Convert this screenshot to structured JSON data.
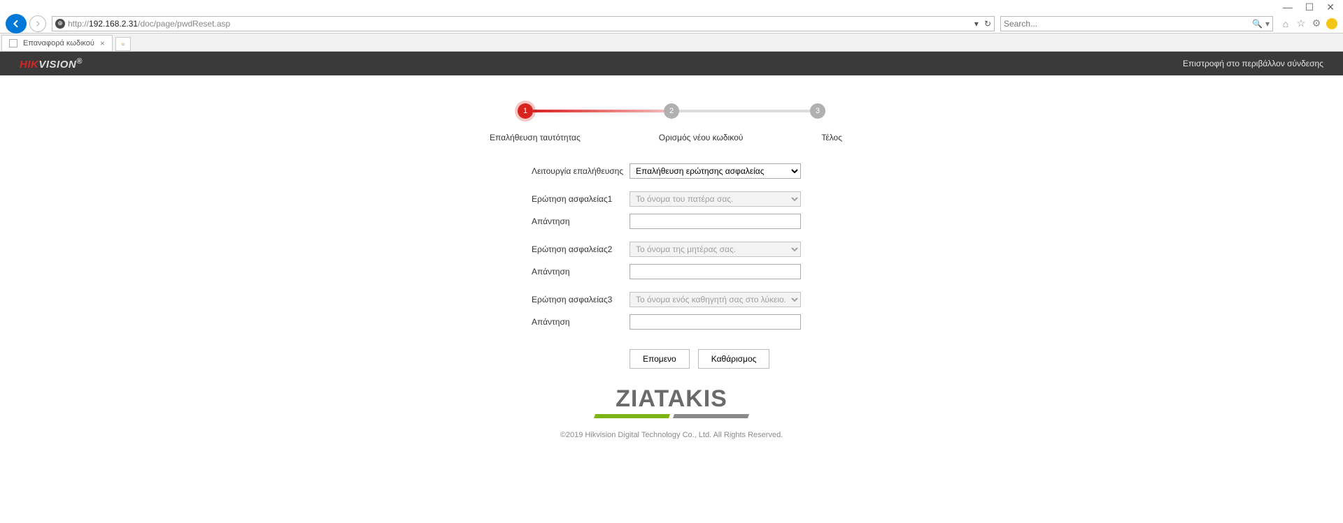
{
  "browser": {
    "url_prefix": "http://",
    "url_host": "192.168.2.31",
    "url_path": "/doc/page/pwdReset.asp",
    "search_placeholder": "Search...",
    "tab_title": "Επαναφορά κωδικού"
  },
  "header": {
    "logo_a": "HIK",
    "logo_b": "VISION",
    "logo_r": "®",
    "return_link": "Επιστροφή στο περιβάλλον σύνδεσης"
  },
  "steps": {
    "s1": "1",
    "s2": "2",
    "s3": "3",
    "label1": "Επαλήθευση ταυτότητας",
    "label2": "Ορισμός νέου κωδικού",
    "label3": "Τέλος"
  },
  "form": {
    "mode_label": "Λειτουργία επαλήθευσης",
    "mode_value": "Επαλήθευση ερώτησης ασφαλείας",
    "q1_label": "Ερώτηση ασφαλείας1",
    "q1_value": "Το όνομα του πατέρα σας.",
    "q2_label": "Ερώτηση ασφαλείας2",
    "q2_value": "Το όνομα της μητέρας σας.",
    "q3_label": "Ερώτηση ασφαλείας3",
    "q3_value": "Το όνομα ενός καθηγητή σας στο λύκειο.",
    "answer_label": "Απάντηση",
    "next": "Επομενο",
    "clear": "Καθάρισμος"
  },
  "brand": {
    "name": "ZIATAKIS"
  },
  "footer": {
    "copyright": "©2019 Hikvision Digital Technology Co., Ltd. All Rights Reserved."
  }
}
